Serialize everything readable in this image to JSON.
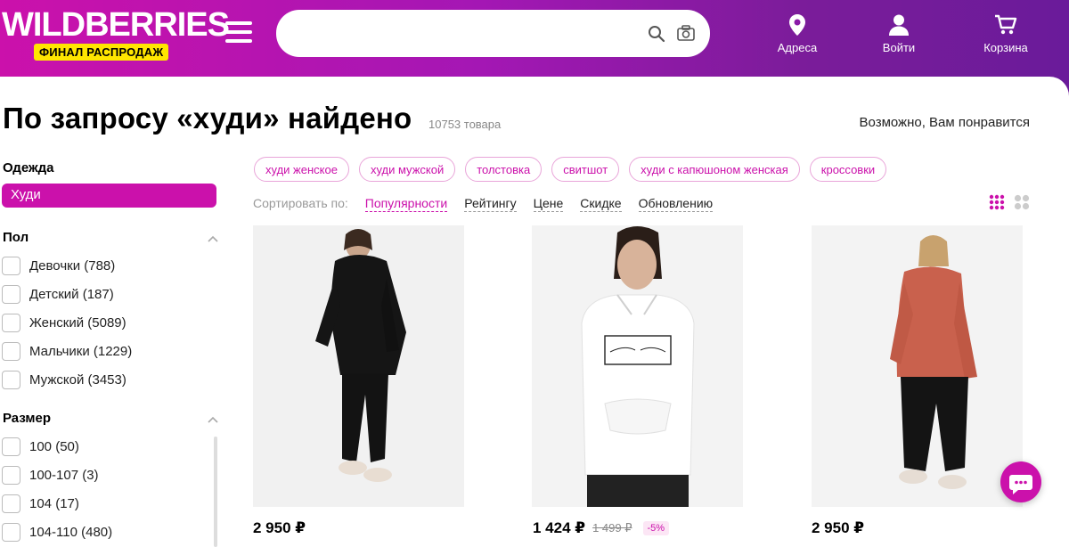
{
  "header": {
    "logo_text": "WILDBERRIES",
    "badge_text": "ФИНАЛ РАСПРОДАЖ",
    "search_placeholder": "",
    "addresses": "Адреса",
    "login": "Войти",
    "cart": "Корзина"
  },
  "page": {
    "title": "По запросу «худи» найдено",
    "count": "10753 товара",
    "maybe_like": "Возможно, Вам понравится"
  },
  "sidebar": {
    "category_head": "Одежда",
    "category_active": "Худи",
    "gender_head": "Пол",
    "gender": [
      "Девочки (788)",
      "Детский (187)",
      "Женский (5089)",
      "Мальчики (1229)",
      "Мужской (3453)"
    ],
    "size_head": "Размер",
    "sizes": [
      "100 (50)",
      "100-107 (3)",
      "104 (17)",
      "104-110 (480)"
    ]
  },
  "chips": [
    "худи женское",
    "худи мужской",
    "толстовка",
    "свитшот",
    "худи с капюшоном женская",
    "кроссовки"
  ],
  "sort": {
    "label": "Сортировать по:",
    "options": [
      "Популярности",
      "Рейтингу",
      "Цене",
      "Скидке",
      "Обновлению"
    ]
  },
  "products": [
    {
      "price": "2 950 ₽",
      "old_price": "",
      "discount": ""
    },
    {
      "price": "1 424 ₽",
      "old_price": "1 499 ₽",
      "discount": "-5%"
    },
    {
      "price": "2 950 ₽",
      "old_price": "",
      "discount": ""
    }
  ],
  "colors": {
    "brand": "#cb11ab",
    "badge": "#ffe600",
    "header_end": "#6a1b9a"
  },
  "icons": [
    "menu-icon",
    "search-icon",
    "camera-icon",
    "location-pin-icon",
    "user-icon",
    "cart-icon",
    "chevron-up-icon",
    "grid-view-icon",
    "large-view-icon",
    "chat-icon"
  ]
}
